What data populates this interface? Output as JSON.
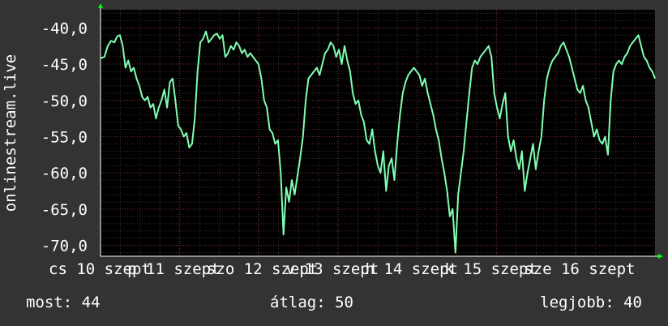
{
  "chart_data": {
    "type": "line",
    "title": "",
    "xlabel": "",
    "ylabel": "onlinestream.live",
    "ylim": [
      -71.5,
      -37.5
    ],
    "y_ticks": [
      -40,
      -45,
      -50,
      -55,
      -60,
      -65,
      -70
    ],
    "y_tick_labels": [
      "-40,0",
      "-45,0",
      "-50,0",
      "-55,0",
      "-60,0",
      "-65,0",
      "-70,0"
    ],
    "xlim": [
      0,
      100
    ],
    "x_tick_labels": [
      {
        "x": 0.0,
        "label": "cs 10 szept"
      },
      {
        "x": 14.2,
        "label": "p 11 szept"
      },
      {
        "x": 28.5,
        "label": "szo 12 szept"
      },
      {
        "x": 42.8,
        "label": "v 13 szept"
      },
      {
        "x": 57.1,
        "label": "h 14 szept"
      },
      {
        "x": 71.4,
        "label": "k 15 szept"
      },
      {
        "x": 85.7,
        "label": "sze 16 szept"
      }
    ],
    "grid": true,
    "line_color": "#7fffb2",
    "series": [
      {
        "values": [
          [
            0.0,
            -44.2
          ],
          [
            0.7,
            -44.0
          ],
          [
            1.3,
            -42.5
          ],
          [
            1.9,
            -41.8
          ],
          [
            2.5,
            -42.0
          ],
          [
            3.0,
            -41.2
          ],
          [
            3.5,
            -41.0
          ],
          [
            4.0,
            -42.5
          ],
          [
            4.5,
            -45.5
          ],
          [
            5.0,
            -44.5
          ],
          [
            5.5,
            -46.0
          ],
          [
            6.0,
            -45.5
          ],
          [
            6.5,
            -47.0
          ],
          [
            7.0,
            -48.0
          ],
          [
            7.5,
            -49.5
          ],
          [
            8.0,
            -50.0
          ],
          [
            8.5,
            -49.5
          ],
          [
            9.0,
            -51.0
          ],
          [
            9.5,
            -50.5
          ],
          [
            10.0,
            -52.5
          ],
          [
            10.5,
            -51.0
          ],
          [
            11.0,
            -50.0
          ],
          [
            11.5,
            -48.5
          ],
          [
            12.0,
            -51.0
          ],
          [
            12.5,
            -47.5
          ],
          [
            13.0,
            -47.0
          ],
          [
            13.5,
            -50.0
          ],
          [
            14.0,
            -53.5
          ],
          [
            14.5,
            -54.0
          ],
          [
            15.0,
            -55.0
          ],
          [
            15.5,
            -54.5
          ],
          [
            16.0,
            -56.5
          ],
          [
            16.5,
            -56.0
          ],
          [
            17.0,
            -52.5
          ],
          [
            17.5,
            -46.0
          ],
          [
            18.0,
            -42.0
          ],
          [
            18.5,
            -41.5
          ],
          [
            19.0,
            -40.5
          ],
          [
            19.5,
            -42.0
          ],
          [
            20.0,
            -41.5
          ],
          [
            20.5,
            -41.0
          ],
          [
            21.0,
            -40.8
          ],
          [
            21.5,
            -41.5
          ],
          [
            22.0,
            -41.0
          ],
          [
            22.5,
            -44.0
          ],
          [
            23.0,
            -43.5
          ],
          [
            23.5,
            -42.5
          ],
          [
            24.0,
            -43.0
          ],
          [
            24.5,
            -42.0
          ],
          [
            25.0,
            -42.5
          ],
          [
            25.5,
            -43.5
          ],
          [
            26.0,
            -43.0
          ],
          [
            26.5,
            -44.0
          ],
          [
            27.0,
            -43.5
          ],
          [
            27.5,
            -44.0
          ],
          [
            28.0,
            -44.5
          ],
          [
            28.5,
            -45.0
          ],
          [
            29.0,
            -47.0
          ],
          [
            29.5,
            -50.0
          ],
          [
            30.0,
            -51.0
          ],
          [
            30.5,
            -54.0
          ],
          [
            31.0,
            -54.5
          ],
          [
            31.5,
            -56.0
          ],
          [
            32.0,
            -55.5
          ],
          [
            32.5,
            -60.0
          ],
          [
            33.0,
            -68.5
          ],
          [
            33.5,
            -62.0
          ],
          [
            34.0,
            -64.0
          ],
          [
            34.5,
            -61.0
          ],
          [
            35.0,
            -63.0
          ],
          [
            35.5,
            -60.5
          ],
          [
            36.0,
            -58.0
          ],
          [
            36.5,
            -55.0
          ],
          [
            37.0,
            -50.0
          ],
          [
            37.5,
            -47.0
          ],
          [
            38.0,
            -46.5
          ],
          [
            38.5,
            -46.0
          ],
          [
            39.0,
            -45.5
          ],
          [
            39.5,
            -46.5
          ],
          [
            40.0,
            -45.0
          ],
          [
            40.5,
            -43.5
          ],
          [
            41.0,
            -43.0
          ],
          [
            41.5,
            -42.0
          ],
          [
            42.0,
            -42.5
          ],
          [
            42.5,
            -44.0
          ],
          [
            43.0,
            -43.0
          ],
          [
            43.5,
            -45.0
          ],
          [
            44.0,
            -42.5
          ],
          [
            44.5,
            -44.5
          ],
          [
            45.0,
            -46.0
          ],
          [
            45.5,
            -49.0
          ],
          [
            46.0,
            -50.5
          ],
          [
            46.5,
            -50.0
          ],
          [
            47.0,
            -52.0
          ],
          [
            47.5,
            -53.0
          ],
          [
            48.0,
            -55.5
          ],
          [
            48.5,
            -56.0
          ],
          [
            49.0,
            -54.0
          ],
          [
            49.5,
            -57.0
          ],
          [
            50.0,
            -59.0
          ],
          [
            50.5,
            -60.0
          ],
          [
            51.0,
            -57.0
          ],
          [
            51.5,
            -62.5
          ],
          [
            52.0,
            -59.0
          ],
          [
            52.5,
            -58.0
          ],
          [
            53.0,
            -61.0
          ],
          [
            53.5,
            -56.0
          ],
          [
            54.0,
            -52.0
          ],
          [
            54.5,
            -49.0
          ],
          [
            55.0,
            -47.5
          ],
          [
            55.5,
            -46.5
          ],
          [
            56.0,
            -46.0
          ],
          [
            56.5,
            -45.5
          ],
          [
            57.0,
            -46.0
          ],
          [
            57.5,
            -46.5
          ],
          [
            58.0,
            -48.0
          ],
          [
            58.5,
            -47.0
          ],
          [
            59.0,
            -49.0
          ],
          [
            59.5,
            -50.5
          ],
          [
            60.0,
            -52.0
          ],
          [
            60.5,
            -54.0
          ],
          [
            61.0,
            -55.5
          ],
          [
            61.5,
            -58.0
          ],
          [
            62.0,
            -60.0
          ],
          [
            62.5,
            -62.5
          ],
          [
            63.0,
            -66.0
          ],
          [
            63.5,
            -65.0
          ],
          [
            64.0,
            -71.0
          ],
          [
            64.5,
            -63.0
          ],
          [
            65.0,
            -60.0
          ],
          [
            65.5,
            -57.0
          ],
          [
            66.0,
            -53.0
          ],
          [
            66.5,
            -49.0
          ],
          [
            67.0,
            -45.5
          ],
          [
            67.5,
            -44.5
          ],
          [
            68.0,
            -45.0
          ],
          [
            68.5,
            -44.0
          ],
          [
            69.0,
            -43.5
          ],
          [
            69.5,
            -43.0
          ],
          [
            70.0,
            -42.5
          ],
          [
            70.5,
            -44.0
          ],
          [
            71.0,
            -49.0
          ],
          [
            71.5,
            -51.0
          ],
          [
            72.0,
            -52.5
          ],
          [
            72.5,
            -50.5
          ],
          [
            73.0,
            -49.0
          ],
          [
            73.5,
            -55.0
          ],
          [
            74.0,
            -57.0
          ],
          [
            74.5,
            -55.5
          ],
          [
            75.0,
            -58.0
          ],
          [
            75.5,
            -59.5
          ],
          [
            76.0,
            -57.0
          ],
          [
            76.5,
            -62.5
          ],
          [
            77.0,
            -60.0
          ],
          [
            77.5,
            -58.0
          ],
          [
            78.0,
            -56.0
          ],
          [
            78.5,
            -59.5
          ],
          [
            79.0,
            -57.0
          ],
          [
            79.5,
            -55.0
          ],
          [
            80.0,
            -50.0
          ],
          [
            80.5,
            -47.0
          ],
          [
            81.0,
            -45.5
          ],
          [
            81.5,
            -44.5
          ],
          [
            82.0,
            -44.0
          ],
          [
            82.5,
            -43.5
          ],
          [
            83.0,
            -42.5
          ],
          [
            83.5,
            -42.0
          ],
          [
            84.0,
            -43.0
          ],
          [
            84.5,
            -44.0
          ],
          [
            85.0,
            -45.5
          ],
          [
            85.5,
            -47.0
          ],
          [
            86.0,
            -48.5
          ],
          [
            86.5,
            -49.0
          ],
          [
            87.0,
            -48.0
          ],
          [
            87.5,
            -50.0
          ],
          [
            88.0,
            -51.0
          ],
          [
            88.5,
            -53.0
          ],
          [
            89.0,
            -55.0
          ],
          [
            89.5,
            -54.0
          ],
          [
            90.0,
            -55.5
          ],
          [
            90.5,
            -56.0
          ],
          [
            91.0,
            -55.0
          ],
          [
            91.5,
            -57.5
          ],
          [
            92.0,
            -50.0
          ],
          [
            92.5,
            -46.0
          ],
          [
            93.0,
            -45.0
          ],
          [
            93.5,
            -44.5
          ],
          [
            94.0,
            -45.0
          ],
          [
            94.5,
            -44.0
          ],
          [
            95.0,
            -43.5
          ],
          [
            95.5,
            -42.5
          ],
          [
            96.0,
            -42.0
          ],
          [
            96.5,
            -41.5
          ],
          [
            97.0,
            -41.0
          ],
          [
            97.5,
            -42.5
          ],
          [
            98.0,
            -44.0
          ],
          [
            98.5,
            -44.5
          ],
          [
            99.0,
            -45.5
          ],
          [
            99.5,
            -46.0
          ],
          [
            100.0,
            -47.0
          ]
        ]
      }
    ]
  },
  "footer": {
    "current": "most: 44",
    "average": "átlag: 50",
    "max": "legjobb: 40"
  }
}
